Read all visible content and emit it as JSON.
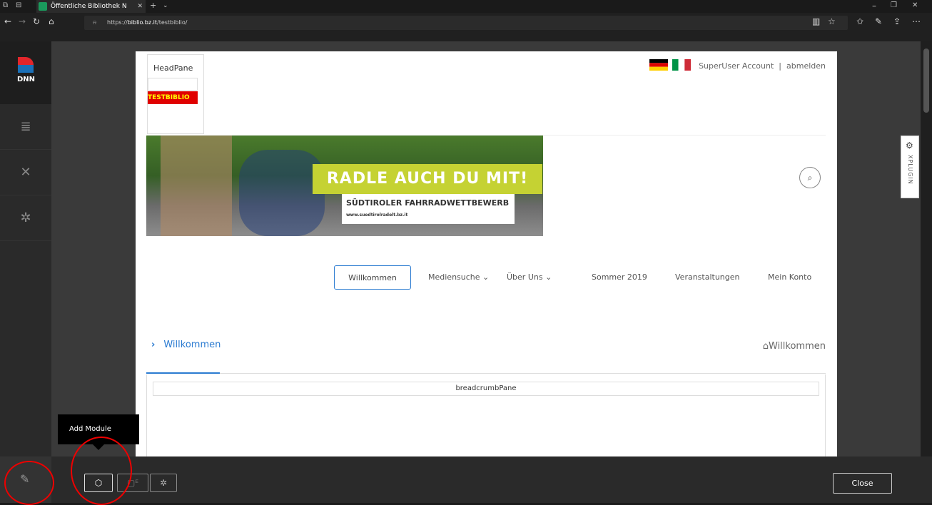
{
  "browser": {
    "tab_title": "Öffentliche Bibliothek N",
    "url_prefix": "https://",
    "url_host": "biblio.bz.it",
    "url_path": "/testbiblio/"
  },
  "persona_bar": {
    "logo_text": "DNN"
  },
  "header": {
    "headpane_label": "HeadPane",
    "testbiblio_label": "TESTBIBLIO",
    "account_label": "SuperUser Account",
    "separator": "|",
    "logout_label": "abmelden"
  },
  "banner": {
    "title": "RADLE AUCH DU MIT!",
    "subtitle": "SÜDTIROLER FAHRRADWETTBEWERB",
    "url_text": "www.suedtirolradelt.bz.it"
  },
  "nav": {
    "items": [
      {
        "label": "Willkommen"
      },
      {
        "label": "Mediensuche ⌄"
      },
      {
        "label": "Über Uns ⌄"
      },
      {
        "label": "Sommer 2019"
      },
      {
        "label": "Veranstaltungen"
      },
      {
        "label": "Mein Konto"
      }
    ]
  },
  "content": {
    "page_title": "Willkommen",
    "home_breadcrumb": "Willkommen",
    "breadcrumb_pane": "breadcrumbPane"
  },
  "xplugin": {
    "label": "XPLUGIN"
  },
  "editbar": {
    "tooltip": "Add Module",
    "close_label": "Close"
  },
  "colors": {
    "accent": "#2b7bd1",
    "highlight_circle": "#e00000",
    "testbiblio_bg": "#e00000"
  }
}
